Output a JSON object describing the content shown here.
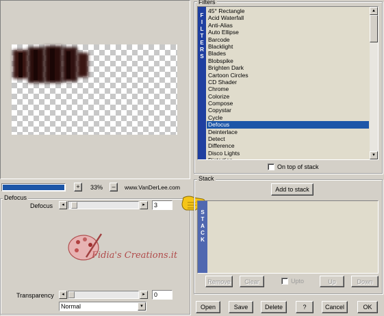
{
  "colors": {
    "selection": "#1c56a8",
    "progress": "#1c56a8",
    "sidebar": "#1f3fa0",
    "stack_sidebar": "#5068b0"
  },
  "preview": {
    "zoom_value": "33%",
    "plus": "+",
    "minus": "–",
    "website": "www.VanDerLee.com"
  },
  "filters": {
    "title": "Filters",
    "sidebar_letters": [
      "F",
      "I",
      "L",
      "T",
      "E",
      "R",
      "S"
    ],
    "items": [
      {
        "label": "45° Rectangle",
        "selected": false
      },
      {
        "label": "Acid Waterfall",
        "selected": false
      },
      {
        "label": "Anti-Alias",
        "selected": false
      },
      {
        "label": "Auto Ellipse",
        "selected": false
      },
      {
        "label": "Barcode",
        "selected": false
      },
      {
        "label": "Blacklight",
        "selected": false
      },
      {
        "label": "Blades",
        "selected": false
      },
      {
        "label": "Blobspike",
        "selected": false
      },
      {
        "label": "Brighten Dark",
        "selected": false
      },
      {
        "label": "Cartoon Circles",
        "selected": false
      },
      {
        "label": "CD Shader",
        "selected": false
      },
      {
        "label": "Chrome",
        "selected": false
      },
      {
        "label": "Colorize",
        "selected": false
      },
      {
        "label": "Compose",
        "selected": false
      },
      {
        "label": "Copystar",
        "selected": false
      },
      {
        "label": "Cycle",
        "selected": false
      },
      {
        "label": "Defocus",
        "selected": true
      },
      {
        "label": "Deinterlace",
        "selected": false
      },
      {
        "label": "Detect",
        "selected": false
      },
      {
        "label": "Difference",
        "selected": false
      },
      {
        "label": "Disco Lights",
        "selected": false
      },
      {
        "label": "Distortion",
        "selected": false
      }
    ],
    "on_top_label": "On top of stack"
  },
  "params": {
    "group_title": "Defocus",
    "defocus_label": "Defocus",
    "defocus_value": "3",
    "defocus_fraction": 0.03
  },
  "watermark": {
    "text": "Fidia's Creations.it"
  },
  "stack": {
    "title": "Stack",
    "add_label": "Add to stack",
    "sidebar_letters": [
      "S",
      "T",
      "A",
      "C",
      "K"
    ],
    "remove_label": "Remove",
    "clear_label": "Clear",
    "upto_label": "Upto",
    "up_label": "Up",
    "down_label": "Down"
  },
  "transparency": {
    "label": "Transparency",
    "value": "0",
    "blend_mode": "Normal"
  },
  "footer": {
    "open": "Open",
    "save": "Save",
    "delete": "Delete",
    "help": "?",
    "cancel": "Cancel",
    "ok": "OK"
  }
}
